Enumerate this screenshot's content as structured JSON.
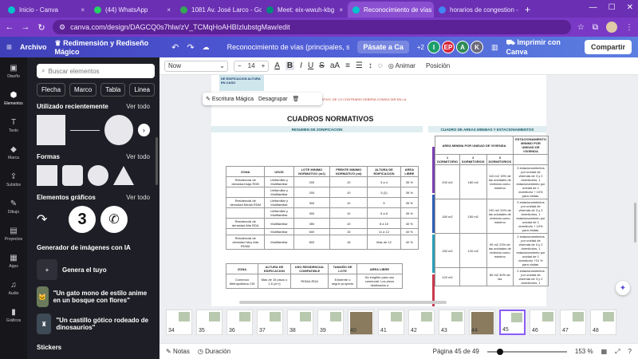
{
  "browser": {
    "tabs": [
      {
        "title": "Inicio - Canva",
        "color": "#00c4cc"
      },
      {
        "title": "(44) WhatsApp",
        "color": "#25d366"
      },
      {
        "title": "1081 Av. José Larco - Goo",
        "color": "#34a853"
      },
      {
        "title": "Meet: eix-wwuh-kbg",
        "color": "#00897b"
      },
      {
        "title": "Reconocimiento de vías (p",
        "color": "#00c4cc",
        "active": true
      },
      {
        "title": "horarios de congestion - B",
        "color": "#4285f4"
      }
    ],
    "url": "canva.com/design/DAGCQ0s7hlw/zV_TCMqHoAHBIzlubstgMaw/edit"
  },
  "toolbar": {
    "home": "Archivo",
    "resize": "Redimensión y Rediseño Mágico",
    "doc_title": "Reconocimiento de vías (principales, secundari...",
    "pro": "Pásate a Ca",
    "count": "+2",
    "avatars": [
      {
        "letter": "I",
        "color": "#1b9e6a"
      },
      {
        "letter": "EP",
        "color": "#d7263d"
      },
      {
        "letter": "A",
        "color": "#2e8b57"
      },
      {
        "letter": "K",
        "color": "#6b6b7b"
      }
    ],
    "print": "Imprimir con Canva",
    "share": "Compartir"
  },
  "rail": [
    "Diseño",
    "Elementos",
    "Texto",
    "Marca",
    "Subidos",
    "Dibujo",
    "Proyectos",
    "Apps",
    "Audio",
    "Gráficos"
  ],
  "panel": {
    "search_placeholder": "Buscar elementos",
    "chips": [
      "Flecha",
      "Marco",
      "Tabla",
      "Linea"
    ],
    "recent": "Utilizado recientemente",
    "forms": "Formas",
    "graphics": "Elementos gráficos",
    "see_all": "Ver todo",
    "generator": "Generador de imágenes con IA",
    "gen_own": "Genera el tuyo",
    "prompt1": "\"Un gato mono de estilo anime en un bosque con flores\"",
    "prompt2": "\"Un castillo gótico rodeado de dinosaurios\"",
    "stickers": "Stickers",
    "graphic_number": "3"
  },
  "subbar": {
    "font": "Now",
    "size": "14",
    "animate": "Animar",
    "position": "Posición"
  },
  "context_menu": {
    "magic": "Escritura Mágica",
    "ungroup": "Desagrupar"
  },
  "page": {
    "title": "CUADROS NORMATIVOS",
    "left_band": "RESUMEN DE ZONIFICACION",
    "right_band": "CUADRO DE AREAS MINIMAS Y ESTACIONAMIENTOS",
    "red_note": "AL NORMATIVO, DE LO CONTRARIO DEBERA CONSULTAR EN LA",
    "top_box": "DE EDIFICACION ALTURA EN CASO",
    "zone_headers": [
      "ZONA",
      "USOS",
      "LOTE MINIMO NORMATIVO (m2)",
      "FRENTE MINIMO NORMATIVO (ml)",
      "ALTURA DE EDIFICACION",
      "AREA LIBRE"
    ],
    "zone_rows": [
      [
        "Residencial de densidad baja RDB",
        "Unifamiliar y Multifamiliar",
        "200",
        "10",
        "3 a 4",
        "35 %"
      ],
      [
        "",
        "Unifamiliar y Multifamiliar",
        "200",
        "10",
        "5 (2)",
        "35 %"
      ],
      [
        "Residencial de densidad Media RDM",
        "Unifamiliar y Multifamiliar",
        "300",
        "10",
        "5",
        "35 %"
      ],
      [
        "",
        "Unifamiliar y Multifamiliar",
        "300",
        "10",
        "5 a 8",
        "35 %"
      ],
      [
        "Residencial de densidad Alta RDA",
        "Multifamiliar",
        "350",
        "10",
        "8 a 10",
        "40 %"
      ],
      [
        "",
        "Multifamiliar",
        "600",
        "15",
        "11 a 12",
        "40 %"
      ],
      [
        "Residencial de densidad Muy Alta RDMA",
        "Multifamiliar",
        "800",
        "18",
        "Más de 12",
        "40 %"
      ]
    ],
    "area_headers": [
      "AREA MINIMA POR UNIDAD DE VIVIENDA",
      "ESTACIONAMIENTO MINIMO POR UNIDAD DE VIVIENDA"
    ],
    "area_sub": [
      "1 DORMITORIO",
      "2 DORMITORIOS",
      "3 DORMITORIOS"
    ],
    "area_rows": [
      [
        "200 m2",
        "180 m2",
        "110 m2 15% de las unidades de vivienda como máximo",
        "3 estacionamientos por unidad de vivienda de 3 y 2 dormitorios, 1 estacionamiento por unidad de 1 dormitorio + 10% para visitas."
      ],
      [
        "180 m2",
        "150 m2",
        "100 m2 20% de las unidades de vivienda como máximo",
        "3 estacionamientos por unidad de vivienda de 3 y 2 dormitorios, 1 estacionamiento por unidad de 1 dormitorio + 10% para visitas."
      ],
      [
        "150 m2",
        "120 m2",
        "90 m2 23% de las unidades de vivienda como máximo",
        "2 estacionamientos por unidad de vivienda de 3 y 2 dormitorios, 1 estacionamiento por unidad de 1 dormitorio +10 % para visitas."
      ],
      [
        "120 m2",
        "",
        "80 m2 30% de las",
        "2 estacionamientos por unidad de vivienda de 3 y 2 dormitorios, 1"
      ]
    ],
    "lower_headers": [
      "ZONA",
      "ALTURA DE EDIFICACION",
      "USO RESIDENCIAL COMPATIBLE",
      "TAMAÑO DE LOTE",
      "AREA LIBRE"
    ],
    "lower_rows": [
      [
        "Comercio Metropolitano CM",
        "Más de 15 pisos o 1.5 (a+r)",
        "RDMA-RDA",
        "Existente o según proyecto",
        "No exigible para uso comercial. Los pisos destinados a"
      ]
    ]
  },
  "strip": {
    "pages": [
      "34",
      "35",
      "36",
      "37",
      "38",
      "39",
      "40",
      "41",
      "42",
      "43",
      "44",
      "45",
      "46",
      "47",
      "48"
    ],
    "current": "45"
  },
  "status": {
    "notes": "Notas",
    "duration": "Duración",
    "page": "Página 45 de 49",
    "zoom": "153 %",
    "zoom_fraction": 0.12
  }
}
